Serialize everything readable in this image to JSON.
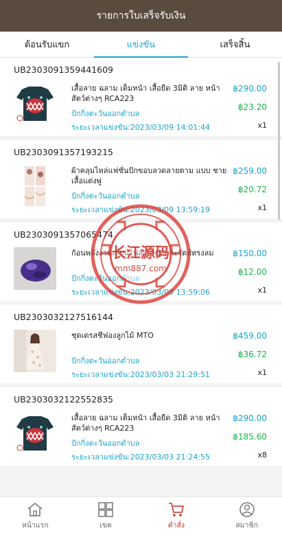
{
  "header": {
    "title": "รายการใบเสร็จรับเงิน"
  },
  "tabs": [
    {
      "label": "ต้อนรับแขก",
      "active": false
    },
    {
      "label": "แข่งขัน",
      "active": true
    },
    {
      "label": "เสร็จสิ้น",
      "active": false
    }
  ],
  "orders": [
    {
      "id": "UB2303091359441609",
      "title": "เสื้อลาย ฉลาม เต็มหน้า เสื้อยืด 3มิติ ลาย หน้าสัตว์ต่างๆ RCA223",
      "status": "ปักกิ่งตะวันออกตำบล",
      "time": "ระยะเวลาแข่งขัน:2023/03/09 14:01:44",
      "price": "฿290.00",
      "profit": "฿23.20",
      "qty": "x1",
      "image": "shark-shirt"
    },
    {
      "id": "UB2303091357193215",
      "title": "ผ้าคลุมไหล่แฟชั่นปักขอบลวดลายตาม แบบ ชายเสื้อแต่งพู่",
      "status": "ปักกิ่งตะวันออกตำบล",
      "time": "ระยะเวลาแข่งขัน:2023/03/09 13:59:19",
      "price": "฿259.00",
      "profit": "฿20.72",
      "qty": "x1",
      "image": "shawl"
    },
    {
      "id": "UB2303091357065474",
      "title": "ก้อนพลังงานเทียนไฟส์ 13.35 กะรัตส์ทรงลม",
      "status": "ปักกิ่งตะวันออกตำบล",
      "time": "ระยะเวลาแข่งขัน:2023/03/09 13:59:06",
      "price": "฿150.00",
      "profit": "฿12.00",
      "qty": "x1",
      "image": "purple-gem"
    },
    {
      "id": "UB2303032127516144",
      "title": "ชุดเดรสชีฟองลูกไม้ MTO",
      "status": "ปักกิ่งตะวันออกตำบล",
      "time": "ระยะเวลาแข่งขัน:2023/03/03 21:29:51",
      "price": "฿459.00",
      "profit": "฿36.72",
      "qty": "x1",
      "image": "dress"
    },
    {
      "id": "UB2303032122552835",
      "title": "เสื้อลาย ฉลาม เต็มหน้า เสื้อยืด 3มิติ ลาย หน้าสัตว์ต่างๆ RCA223",
      "status": "ปักกิ่งตะวันออกตำบล",
      "time": "ระยะเวลาแข่งขัน:2023/03/03 21:24:55",
      "price": "฿290.00",
      "profit": "฿185.60",
      "qty": "x8",
      "image": "shark-shirt"
    }
  ],
  "bottom_nav": [
    {
      "label": "หน้าแรก",
      "icon": "home-icon",
      "active": false
    },
    {
      "label": "เขต",
      "icon": "grid-icon",
      "active": false
    },
    {
      "label": "คำสั่ง",
      "icon": "cart-icon",
      "active": true
    },
    {
      "label": "สมาชิก",
      "icon": "user-icon",
      "active": false
    }
  ],
  "watermark": {
    "text": "长江源码",
    "subtext": "mm887.com"
  },
  "colors": {
    "header_bg": "#5a4b3f",
    "accent": "#1aa3c8",
    "profit": "#18b34a",
    "nav_active": "#c0392b",
    "watermark": "#d9342b"
  }
}
